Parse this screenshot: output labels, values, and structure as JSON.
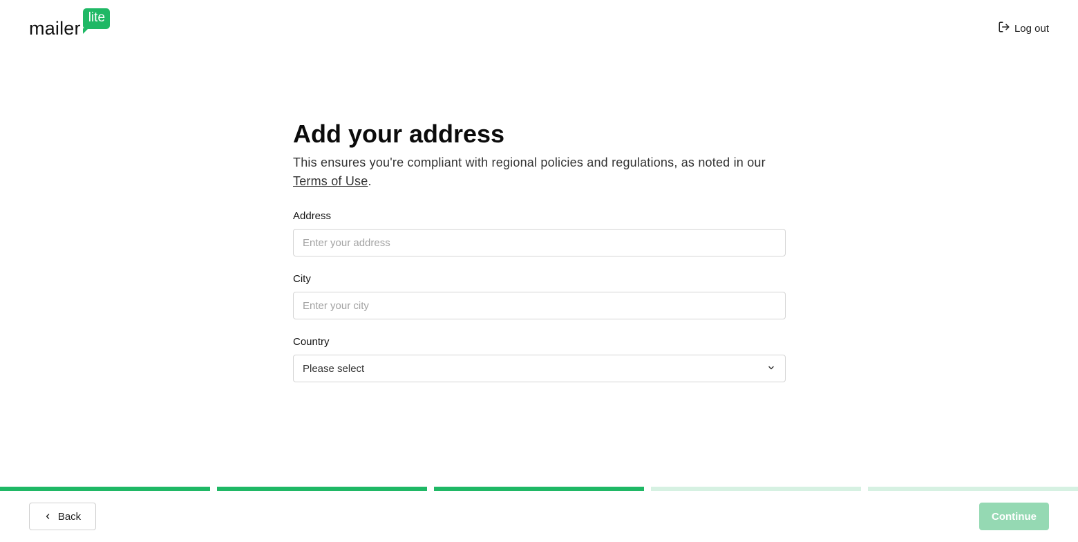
{
  "header": {
    "logo_text": "mailer",
    "logo_badge": "lite",
    "logout_label": "Log out"
  },
  "main": {
    "title": "Add your address",
    "subtitle_text": "This ensures you're compliant with regional policies and regulations, as noted in our",
    "subtitle_link": "Terms of Use",
    "subtitle_end": "."
  },
  "form": {
    "address": {
      "label": "Address",
      "placeholder": "Enter your address",
      "value": ""
    },
    "city": {
      "label": "City",
      "placeholder": "Enter your city",
      "value": ""
    },
    "country": {
      "label": "Country",
      "selected": "Please select"
    }
  },
  "progress": {
    "total_steps": 5,
    "completed_steps": 3
  },
  "footer": {
    "back_label": "Back",
    "continue_label": "Continue",
    "continue_disabled": true
  },
  "colors": {
    "brand": "#1fb865",
    "progress_todo": "#d6f1e2",
    "continue_disabled_bg": "#95d9b3"
  },
  "icons": [
    "log-out-icon",
    "chevron-down-icon",
    "chevron-left-icon"
  ]
}
